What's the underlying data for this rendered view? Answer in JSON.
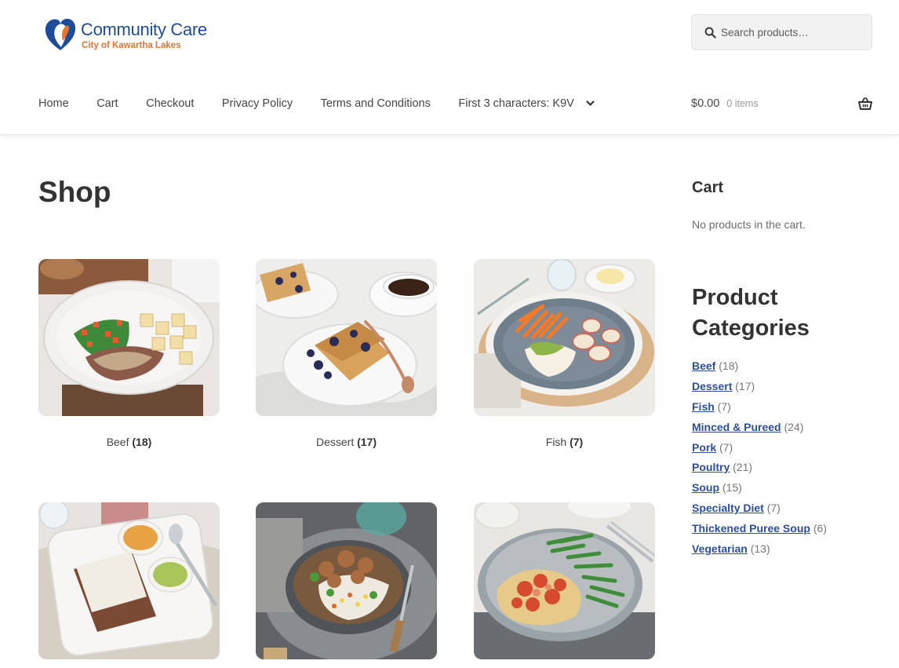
{
  "brand": {
    "title": "Community Care",
    "subtitle": "City of Kawartha Lakes"
  },
  "search": {
    "placeholder": "Search products…"
  },
  "nav": {
    "items": [
      "Home",
      "Cart",
      "Checkout",
      "Privacy Policy",
      "Terms and Conditions"
    ],
    "dropdown_label": "First 3 characters: K9V"
  },
  "mini_cart": {
    "amount": "$0.00",
    "count": "0 items"
  },
  "page_title": "Shop",
  "products": [
    {
      "name": "Beef",
      "count": "(18)",
      "image": "roast beef plate with vegetables and potatoes"
    },
    {
      "name": "Dessert",
      "count": "(17)",
      "image": "blueberry cake with coffee"
    },
    {
      "name": "Fish",
      "count": "(7)",
      "image": "fish fillet with carrots and potatoes"
    },
    {
      "name": "",
      "count": "",
      "image": "shepherd's pie with pureed sides"
    },
    {
      "name": "",
      "count": "",
      "image": "stew with rice"
    },
    {
      "name": "",
      "count": "",
      "image": "chicken pasta with green beans"
    }
  ],
  "sidebar": {
    "cart_title": "Cart",
    "cart_empty": "No products in the cart.",
    "categories_title": "Product Categories",
    "categories": [
      {
        "name": "Beef",
        "count": "(18)"
      },
      {
        "name": "Dessert",
        "count": "(17)"
      },
      {
        "name": "Fish",
        "count": "(7)"
      },
      {
        "name": "Minced & Pureed",
        "count": "(24)"
      },
      {
        "name": "Pork",
        "count": "(7)"
      },
      {
        "name": "Poultry",
        "count": "(21)"
      },
      {
        "name": "Soup",
        "count": "(15)"
      },
      {
        "name": "Specialty Diet",
        "count": "(7)"
      },
      {
        "name": "Thickened Puree Soup",
        "count": "(6)"
      },
      {
        "name": "Vegetarian",
        "count": "(13)"
      }
    ]
  },
  "colors": {
    "brand_blue": "#1f4c9a",
    "brand_orange": "#e8732a",
    "link": "#2c4e9c"
  }
}
